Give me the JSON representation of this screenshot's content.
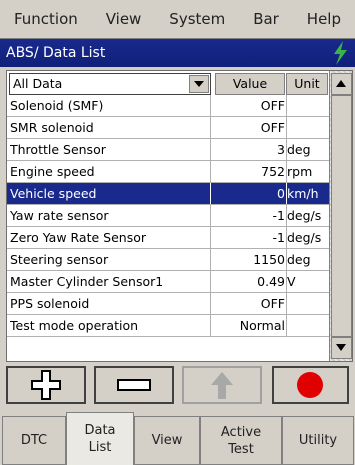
{
  "menu": {
    "items": [
      "Function",
      "View",
      "System",
      "Bar",
      "Help"
    ]
  },
  "window": {
    "title": "ABS/ Data List"
  },
  "filter": {
    "selected": "All Data"
  },
  "table": {
    "columns": {
      "value": "Value",
      "unit": "Unit"
    },
    "rows": [
      {
        "name": "Solenoid (SMF)",
        "value": "OFF",
        "unit": ""
      },
      {
        "name": "SMR solenoid",
        "value": "OFF",
        "unit": ""
      },
      {
        "name": "Throttle Sensor",
        "value": "3",
        "unit": "deg"
      },
      {
        "name": "Engine speed",
        "value": "752",
        "unit": "rpm"
      },
      {
        "name": "Vehicle speed",
        "value": "0",
        "unit": "km/h"
      },
      {
        "name": "Yaw rate sensor",
        "value": "-1",
        "unit": "deg/s"
      },
      {
        "name": "Zero Yaw Rate Sensor",
        "value": "-1",
        "unit": "deg/s"
      },
      {
        "name": "Steering sensor",
        "value": "1150",
        "unit": "deg"
      },
      {
        "name": "Master Cylinder Sensor1",
        "value": "0.49",
        "unit": "V"
      },
      {
        "name": "PPS solenoid",
        "value": "OFF",
        "unit": ""
      },
      {
        "name": "Test mode operation",
        "value": "Normal",
        "unit": ""
      }
    ]
  },
  "actions": {
    "plus": "plus-icon",
    "minus": "minus-icon",
    "up": "up-arrow-icon",
    "record": "record-icon"
  },
  "tabs": [
    {
      "label": "DTC"
    },
    {
      "label": "Data\nList"
    },
    {
      "label": "View"
    },
    {
      "label": "Active\nTest"
    },
    {
      "label": "Utility"
    }
  ],
  "colors": {
    "selection": "#1a2a8c",
    "record": "#e00000",
    "bolt": "#3ab54a"
  }
}
